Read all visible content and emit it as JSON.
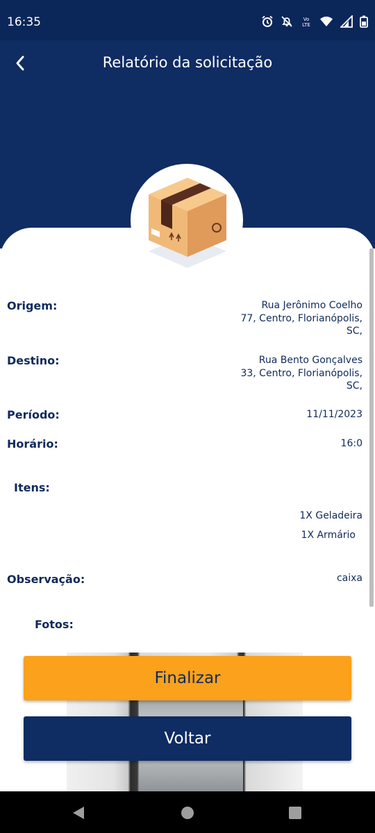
{
  "status_bar": {
    "time": "16:35",
    "network_label": "Vo LTE",
    "icons": [
      "alarm-icon",
      "notifications-off-icon",
      "volte-icon",
      "wifi-icon",
      "signal-icon",
      "battery-icon"
    ]
  },
  "header": {
    "title": "Relatório da solicitação",
    "back_icon": "chevron-left-icon",
    "background": "#0f2c63"
  },
  "illustration": {
    "icon": "package-box-icon"
  },
  "details": {
    "origin_label": "Origem:",
    "origin_line1": "Rua Jerônimo Coelho",
    "origin_line2": "77, Centro, Florianópolis,",
    "origin_line3": "SC,",
    "destination_label": "Destino:",
    "destination_line1": "Rua Bento Gonçalves",
    "destination_line2": "33, Centro, Florianópolis,",
    "destination_line3": "SC,",
    "period_label": "Período:",
    "period_value": "11/11/2023",
    "time_label": "Horário:",
    "time_value": "16:0",
    "items_label": "Itens:",
    "items": [
      "1X Geladeira",
      "1X Armário"
    ],
    "notes_label": "Observação:",
    "notes_value": "caixa",
    "photos_label": "Fotos:"
  },
  "actions": {
    "finalize_label": "Finalizar",
    "back_label": "Voltar",
    "finalize_color": "#fba11b",
    "back_color": "#0f2c63"
  },
  "nav_bar": {
    "icons": [
      "back-triangle-icon",
      "home-circle-icon",
      "recents-square-icon"
    ]
  }
}
